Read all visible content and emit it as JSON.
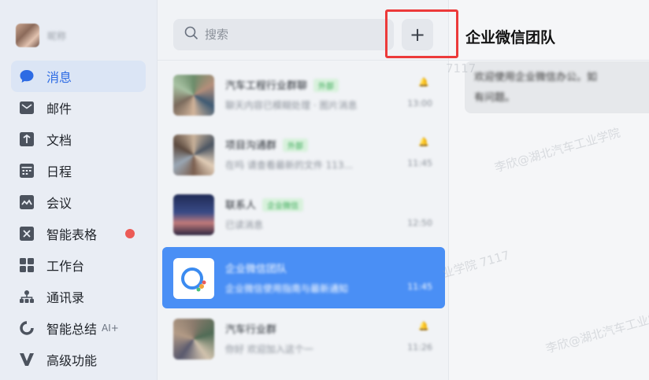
{
  "profile": {
    "name": "昵称"
  },
  "nav": [
    {
      "id": "messages",
      "label": "消息",
      "icon": "chat-bubble-icon",
      "active": true
    },
    {
      "id": "mail",
      "label": "邮件",
      "icon": "mail-icon"
    },
    {
      "id": "docs",
      "label": "文档",
      "icon": "document-icon"
    },
    {
      "id": "calendar",
      "label": "日程",
      "icon": "calendar-icon"
    },
    {
      "id": "meeting",
      "label": "会议",
      "icon": "meeting-icon"
    },
    {
      "id": "smartsheet",
      "label": "智能表格",
      "icon": "smart-sheet-icon",
      "badge": "red-dot"
    },
    {
      "id": "workbench",
      "label": "工作台",
      "icon": "workbench-grid-icon"
    },
    {
      "id": "contacts",
      "label": "通讯录",
      "icon": "contacts-tree-icon"
    },
    {
      "id": "summary",
      "label": "智能总结",
      "suffix": "AI+",
      "icon": "smart-summary-icon"
    },
    {
      "id": "advanced",
      "label": "高级功能",
      "icon": "advanced-v-icon"
    }
  ],
  "search": {
    "placeholder": "搜索"
  },
  "add_button": {
    "label": "+"
  },
  "conversations": [
    {
      "title": "汽车工程行业群聊",
      "tag": "外部",
      "snippet": "聊天内容已模糊处理 · 图片消息",
      "time": "13:00",
      "mute": "🔔"
    },
    {
      "title": "项目沟通群",
      "tag": "外部",
      "snippet": "在吗 请查看最新的文件 113...",
      "time": "11:45",
      "mute": "🔔"
    },
    {
      "title": "联系人",
      "tag": "企业微信",
      "snippet": "已读消息",
      "time": "12:50",
      "mute": ""
    },
    {
      "title": "企业微信团队",
      "tag": "",
      "snippet": "企业微信使用指南与最新通知",
      "time": "11:45",
      "mute": ""
    },
    {
      "title": "汽车行业群",
      "tag": "",
      "snippet": "你好 欢迎加入这个一",
      "time": "11:26",
      "mute": "🔔"
    }
  ],
  "chat": {
    "title": "企业微信团队",
    "message_line1": "欢迎使用企业微信办公。如",
    "message_line2": "有问题。"
  },
  "watermarks": [
    "李欣@湖北汽车工业学院",
    "业学院 7117",
    "李欣@湖北汽车工业学院",
    "7117"
  ]
}
